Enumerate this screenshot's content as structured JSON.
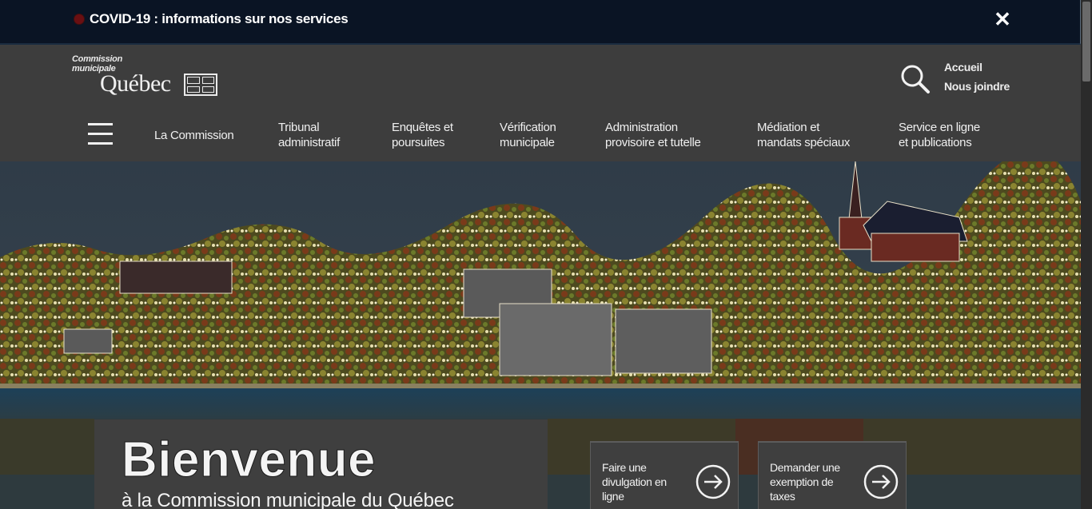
{
  "alert": {
    "text": "COVID-19 : informations sur nos services",
    "close_label": "✕"
  },
  "logo": {
    "line1": "Commission",
    "line2": "municipale",
    "name": "Québec"
  },
  "utility": {
    "home": "Accueil",
    "contact": "Nous joindre"
  },
  "nav": {
    "items": [
      {
        "label": "La Commission"
      },
      {
        "label": "Tribunal\nadministratif"
      },
      {
        "label": "Enquêtes et\npoursuites"
      },
      {
        "label": "Vérification\nmunicipale"
      },
      {
        "label": "Administration\nprovisoire et tutelle"
      },
      {
        "label": "Médiation et\nmandats spéciaux"
      },
      {
        "label": "Service en ligne\net publications"
      }
    ]
  },
  "hero": {
    "title": "Bienvenue",
    "subtitle": "à la Commission municipale du Québec"
  },
  "actions": [
    {
      "label": "Faire une divulgation en ligne"
    },
    {
      "label": "Demander une exemption de taxes"
    }
  ]
}
